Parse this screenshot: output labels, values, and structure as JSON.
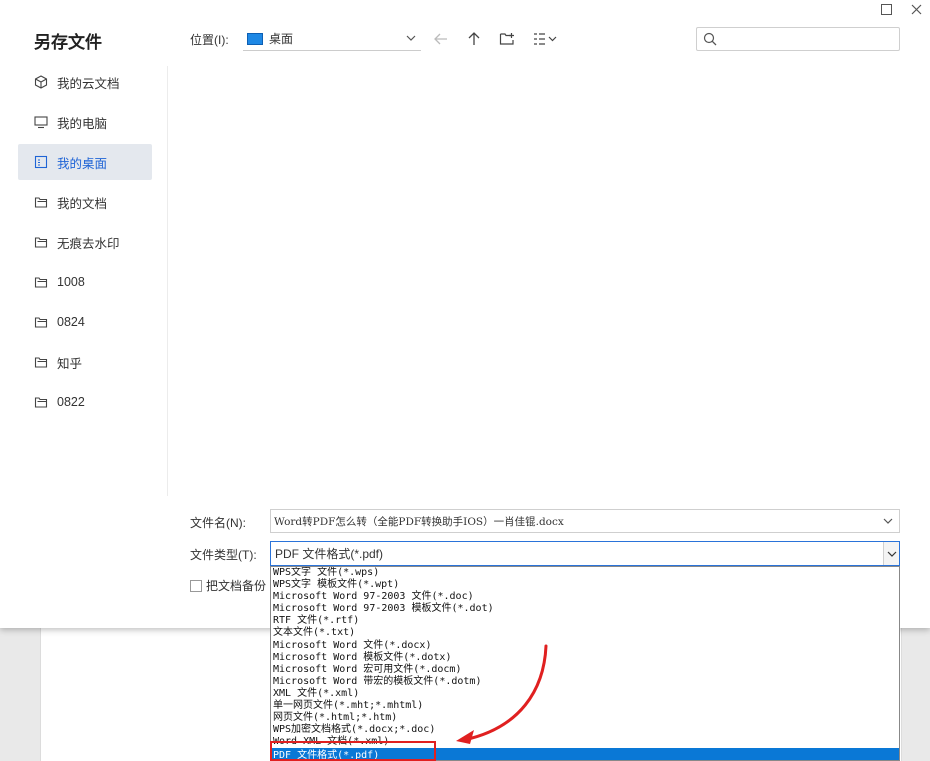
{
  "dialog": {
    "title": "另存文件",
    "window_controls": {
      "maximize": "maximize-icon",
      "close": "close-icon"
    }
  },
  "sidebar": {
    "items": [
      {
        "label": "我的云文档",
        "icon": "cloud-doc-icon",
        "active": false
      },
      {
        "label": "我的电脑",
        "icon": "monitor-icon",
        "active": false
      },
      {
        "label": "我的桌面",
        "icon": "desktop-icon",
        "active": true
      },
      {
        "label": "我的文档",
        "icon": "folder-icon",
        "active": false
      },
      {
        "label": "无痕去水印",
        "icon": "folder-icon",
        "active": false
      },
      {
        "label": "1008",
        "icon": "folder-icon",
        "active": false
      },
      {
        "label": "0824",
        "icon": "folder-icon",
        "active": false
      },
      {
        "label": "知乎",
        "icon": "folder-icon",
        "active": false
      },
      {
        "label": "0822",
        "icon": "folder-icon",
        "active": false
      }
    ]
  },
  "location": {
    "label": "位置(I):",
    "value": "桌面"
  },
  "toolbar": {
    "back": "back-arrow-icon",
    "up": "up-arrow-icon",
    "new_folder": "new-folder-icon",
    "view": "view-list-icon"
  },
  "search": {
    "placeholder": ""
  },
  "filename": {
    "label": "文件名(N):",
    "value": "Word转PDF怎么转（全能PDF转换助手IOS）一肖佳锟.docx"
  },
  "filetype": {
    "label": "文件类型(T):",
    "value": "PDF 文件格式(*.pdf)",
    "options": [
      "WPS文字 文件(*.wps)",
      "WPS文字 模板文件(*.wpt)",
      "Microsoft Word 97-2003 文件(*.doc)",
      "Microsoft Word 97-2003 模板文件(*.dot)",
      "RTF 文件(*.rtf)",
      "文本文件(*.txt)",
      "Microsoft Word 文件(*.docx)",
      "Microsoft Word 模板文件(*.dotx)",
      "Microsoft Word 宏可用文件(*.docm)",
      "Microsoft Word 带宏的模板文件(*.dotm)",
      "XML 文件(*.xml)",
      "单一网页文件(*.mht;*.mhtml)",
      "网页文件(*.html;*.htm)",
      "WPS加密文档格式(*.docx;*.doc)",
      "Word XML 文档(*.xml)",
      "PDF 文件格式(*.pdf)"
    ],
    "selected_index": 15
  },
  "backup": {
    "label": "把文档备份"
  },
  "colors": {
    "accent": "#1f64d6",
    "selection": "#0a78d6",
    "highlight": "#e02020"
  }
}
